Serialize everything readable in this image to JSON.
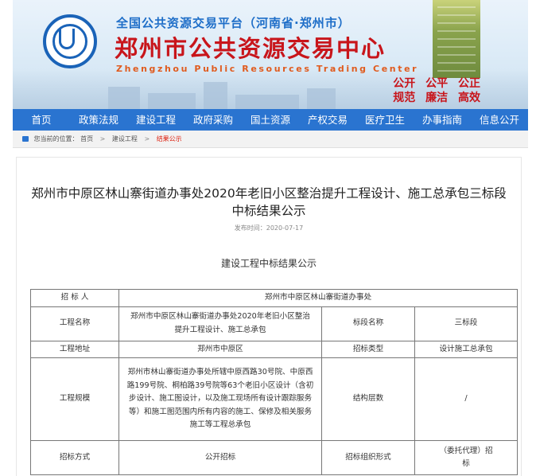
{
  "header": {
    "subtitle": "全国公共资源交易平台（河南省·郑州市）",
    "title": "郑州市公共资源交易中心",
    "en_title": "Zhengzhou Public Resources Trading Center",
    "slogan": [
      "公开",
      "公平",
      "公正",
      "规范",
      "廉洁",
      "高效"
    ],
    "logo_icon": "logo-icon"
  },
  "nav": {
    "items": [
      "首页",
      "政策法规",
      "建设工程",
      "政府采购",
      "国土资源",
      "产权交易",
      "医疗卫生",
      "办事指南",
      "信息公开"
    ]
  },
  "breadcrumb": {
    "prefix": "您当前的位置：",
    "items": [
      "首页",
      "建设工程",
      "结果公示"
    ]
  },
  "article": {
    "title": "郑州市中原区林山寨街道办事处2020年老旧小区整治提升工程设计、施工总承包三标段中标结果公示",
    "date": "发布时间：2020-07-17",
    "section_title": "建设工程中标结果公示",
    "table": {
      "row1": {
        "label": "招 标 人",
        "value": "郑州市中原区林山寨街道办事处"
      },
      "row2": {
        "label": "工程名称",
        "value": "郑州市中原区林山寨街道办事处2020年老旧小区整治提升工程设计、施工总承包",
        "label2": "标段名称",
        "value2": "三标段"
      },
      "row3": {
        "label": "工程地址",
        "value": "郑州市中原区",
        "label2": "招标类型",
        "value2": "设计施工总承包"
      },
      "row4": {
        "label": "工程规模",
        "value": "郑州市林山寨街道办事处所辖中原西路30号院、中原西路199号院、桐柏路39号院等63个老旧小区设计（含初步设计、施工图设计，以及施工现场所有设计跟踪服务等）和施工图范围内所有内容的施工、保修及相关服务施工等工程总承包",
        "label2": "结构层数",
        "value2": "/"
      },
      "row5": {
        "label": "招标方式",
        "value": "公开招标",
        "label2": "招标组织形式",
        "value2": "（委托代理）招标"
      }
    }
  }
}
